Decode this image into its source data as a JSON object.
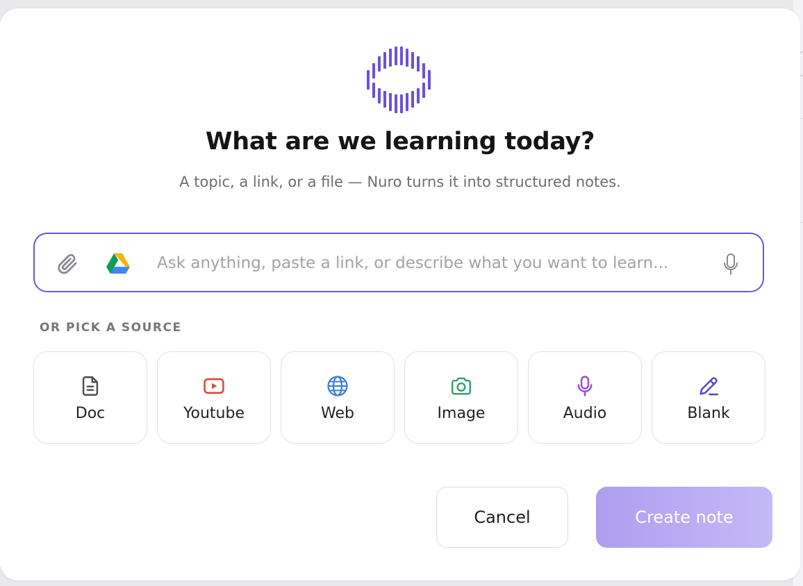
{
  "dialog": {
    "title": "What are we learning today?",
    "subtitle": "A topic, a link, or a file — Nuro turns it into structured notes.",
    "accent_color": "#6a56d4",
    "logo_icon": "nuro-logo-icon"
  },
  "prompt": {
    "value": "",
    "placeholder": "Ask anything, paste a link, or describe what you want to learn...",
    "icons": [
      "paperclip-icon",
      "google-drive-icon",
      "microphone-icon"
    ]
  },
  "sources": {
    "heading": "OR PICK A SOURCE",
    "items": [
      {
        "label": "Doc",
        "icon": "document-icon",
        "color": "#4a4a50"
      },
      {
        "label": "Youtube",
        "icon": "youtube-icon",
        "color": "#d9463c"
      },
      {
        "label": "Web",
        "icon": "globe-icon",
        "color": "#3d7fd6"
      },
      {
        "label": "Image",
        "icon": "camera-icon",
        "color": "#2f9e6e"
      },
      {
        "label": "Audio",
        "icon": "microphone-icon",
        "color": "#9b4fd8"
      },
      {
        "label": "Blank",
        "icon": "pen-icon",
        "color": "#5a48c8"
      }
    ]
  },
  "actions": {
    "cancel_label": "Cancel",
    "create_label": "Create note"
  }
}
